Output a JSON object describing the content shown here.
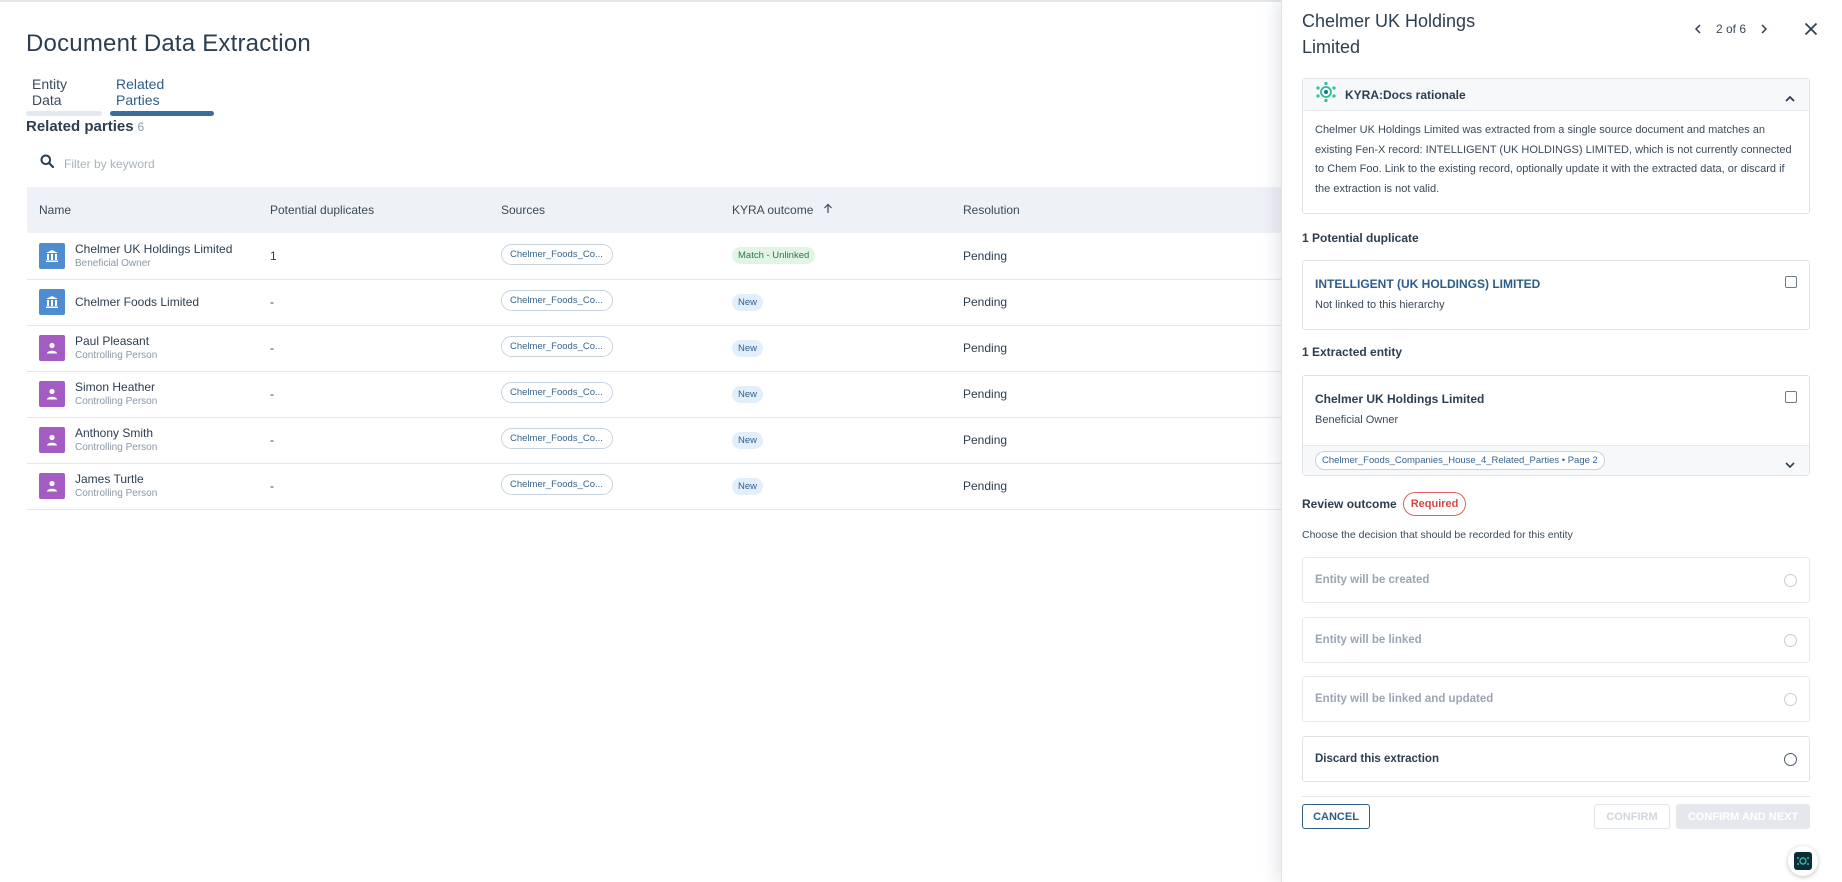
{
  "page": {
    "title": "Document Data Extraction",
    "tabs": [
      {
        "label": "Entity Data",
        "active": false
      },
      {
        "label": "Related Parties",
        "active": true
      }
    ]
  },
  "related_parties": {
    "heading": "Related parties",
    "count": "6",
    "filter_placeholder": "Filter by keyword",
    "columns": [
      "Name",
      "Potential duplicates",
      "Sources",
      "KYRA outcome",
      "Resolution"
    ],
    "sort_column": "KYRA outcome",
    "rows": [
      {
        "name": "Chelmer UK Holdings Limited",
        "role": "Beneficial Owner",
        "type": "organisation",
        "duplicates": "1",
        "source": "Chelmer_Foods_Co...",
        "outcome": "Match - Unlinked",
        "outcome_style": "match",
        "resolution": "Pending"
      },
      {
        "name": "Chelmer Foods Limited",
        "role": "",
        "type": "organisation",
        "duplicates": "-",
        "source": "Chelmer_Foods_Co...",
        "outcome": "New",
        "outcome_style": "new",
        "resolution": "Pending"
      },
      {
        "name": "Paul Pleasant",
        "role": "Controlling Person",
        "type": "person",
        "duplicates": "-",
        "source": "Chelmer_Foods_Co...",
        "outcome": "New",
        "outcome_style": "new",
        "resolution": "Pending"
      },
      {
        "name": "Simon Heather",
        "role": "Controlling Person",
        "type": "person",
        "duplicates": "-",
        "source": "Chelmer_Foods_Co...",
        "outcome": "New",
        "outcome_style": "new",
        "resolution": "Pending"
      },
      {
        "name": "Anthony Smith",
        "role": "Controlling Person",
        "type": "person",
        "duplicates": "-",
        "source": "Chelmer_Foods_Co...",
        "outcome": "New",
        "outcome_style": "new",
        "resolution": "Pending"
      },
      {
        "name": "James Turtle",
        "role": "Controlling Person",
        "type": "person",
        "duplicates": "-",
        "source": "Chelmer_Foods_Co...",
        "outcome": "New",
        "outcome_style": "new",
        "resolution": "Pending"
      }
    ]
  },
  "panel": {
    "title": "Chelmer UK Holdings Limited",
    "pager": "2 of 6",
    "rationale": {
      "title": "KYRA:Docs rationale",
      "body": "Chelmer UK Holdings Limited was extracted from a single source document and matches an existing Fen-X record: INTELLIGENT (UK HOLDINGS) LIMITED, which is not currently connected to Chem Foo. Link to the existing record, optionally update it with the extracted data, or discard if the extraction is not valid."
    },
    "duplicates_label": "1 Potential duplicate",
    "duplicate": {
      "name": "INTELLIGENT (UK HOLDINGS) LIMITED",
      "status": "Not linked to this hierarchy"
    },
    "extracted_label": "1 Extracted entity",
    "extracted": {
      "name": "Chelmer UK Holdings Limited",
      "role": "Beneficial Owner",
      "document": "Chelmer_Foods_Companies_House_4_Related_Parties • Page 2"
    },
    "review": {
      "label": "Review outcome",
      "required": "Required",
      "help": "Choose the decision that should be recorded for this entity",
      "options": [
        {
          "label": "Entity will be created",
          "enabled": false
        },
        {
          "label": "Entity will be linked",
          "enabled": false
        },
        {
          "label": "Entity will be linked and updated",
          "enabled": false
        },
        {
          "label": "Discard this extraction",
          "enabled": true
        }
      ]
    },
    "actions": {
      "cancel": "CANCEL",
      "confirm": "CONFIRM",
      "confirm_next": "CONFIRM AND NEXT"
    }
  },
  "colors": {
    "primary": "#2d5d88",
    "organisation_avatar": "#4f8dd1",
    "person_avatar": "#a45bc2",
    "required": "#d34848",
    "kyra_accent": "#2bbf9a"
  }
}
